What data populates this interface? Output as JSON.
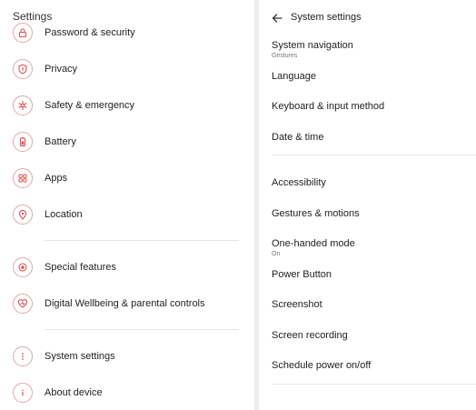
{
  "left": {
    "title": "Settings",
    "groups": [
      [
        {
          "label": "Password & security",
          "icon": "lock-icon"
        },
        {
          "label": "Privacy",
          "icon": "privacy-shield-icon"
        },
        {
          "label": "Safety & emergency",
          "icon": "safety-asterisk-icon"
        },
        {
          "label": "Battery",
          "icon": "battery-icon"
        },
        {
          "label": "Apps",
          "icon": "apps-grid-icon"
        },
        {
          "label": "Location",
          "icon": "location-pin-icon"
        }
      ],
      [
        {
          "label": "Special features",
          "icon": "special-features-icon"
        },
        {
          "label": "Digital Wellbeing & parental controls",
          "icon": "wellbeing-heart-icon"
        }
      ],
      [
        {
          "label": "System settings",
          "icon": "more-vertical-icon"
        },
        {
          "label": "About device",
          "icon": "info-icon"
        }
      ]
    ]
  },
  "right": {
    "title": "System settings",
    "groups": [
      [
        {
          "label": "System navigation",
          "sub": "Gestures"
        },
        {
          "label": "Language"
        },
        {
          "label": "Keyboard & input method"
        },
        {
          "label": "Date & time"
        }
      ],
      [
        {
          "label": "Accessibility"
        },
        {
          "label": "Gestures & motions"
        },
        {
          "label": "One-handed mode",
          "sub": "On"
        },
        {
          "label": "Power Button"
        },
        {
          "label": "Screenshot"
        },
        {
          "label": "Screen recording"
        },
        {
          "label": "Schedule power on/off"
        }
      ]
    ]
  },
  "colors": {
    "icon_accent": "#e04f4f",
    "icon_ring": "#e9a4a4",
    "divider": "#e6e6e6"
  }
}
